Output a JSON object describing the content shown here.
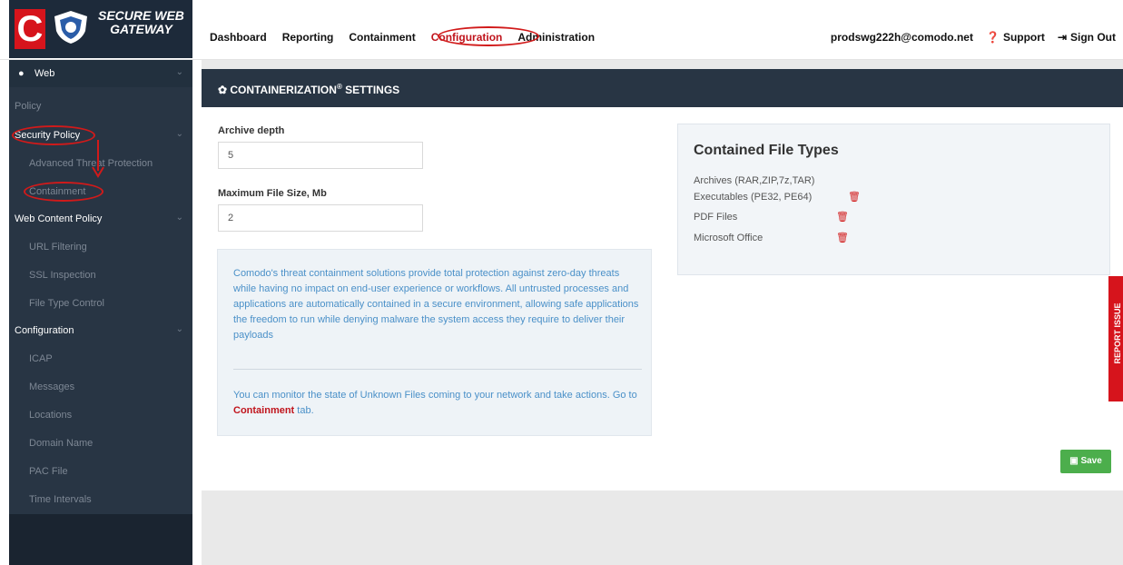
{
  "logo": {
    "line1": "SECURE WEB",
    "line2": "GATEWAY",
    "mark": "C"
  },
  "nav": {
    "items": [
      "Dashboard",
      "Reporting",
      "Containment",
      "Configuration",
      "Administration"
    ],
    "active": "Configuration"
  },
  "account": {
    "email": "prodswg222h@comodo.net",
    "support": "Support",
    "signout": "Sign Out"
  },
  "sidebar": {
    "web": "Web",
    "items": [
      {
        "label": "Policy",
        "kind": "muted"
      },
      {
        "label": "Security Policy",
        "kind": "head"
      },
      {
        "label": "Advanced Threat Protection",
        "kind": "sub"
      },
      {
        "label": "Containment",
        "kind": "sub"
      },
      {
        "label": "Web Content Policy",
        "kind": "head"
      },
      {
        "label": "URL Filtering",
        "kind": "sub"
      },
      {
        "label": "SSL Inspection",
        "kind": "sub"
      },
      {
        "label": "File Type Control",
        "kind": "sub"
      },
      {
        "label": "Configuration",
        "kind": "head"
      },
      {
        "label": "ICAP",
        "kind": "sub"
      },
      {
        "label": "Messages",
        "kind": "sub"
      },
      {
        "label": "Locations",
        "kind": "sub"
      },
      {
        "label": "Domain Name",
        "kind": "sub"
      },
      {
        "label": "PAC File",
        "kind": "sub"
      },
      {
        "label": "Time Intervals",
        "kind": "sub"
      }
    ]
  },
  "panel": {
    "title": "CONTAINERIZATION",
    "title_sup": "®",
    "title_suffix": " SETTINGS",
    "archive_label": "Archive depth",
    "archive_value": "5",
    "maxsize_label": "Maximum File Size, Mb",
    "maxsize_value": "2",
    "info_p1": "Comodo's threat containment solutions provide total protection against zero-day threats while having no impact on end-user experience or workflows. All untrusted processes and applications are automatically contained in a secure environment, allowing safe applications the freedom to run while denying malware the system access they require to deliver their payloads",
    "info_p2_before": "You can monitor the state of Unknown Files coming to your network and take actions. Go to ",
    "info_p2_link": "Containment",
    "info_p2_after": " tab.",
    "types_title": "Contained File Types",
    "types": [
      {
        "label": "Archives (RAR,ZIP,7z,TAR)",
        "deletable": false
      },
      {
        "label": "Executables (PE32, PE64)",
        "deletable": true
      },
      {
        "label": "PDF Files",
        "deletable": true
      },
      {
        "label": "Microsoft Office",
        "deletable": true
      }
    ],
    "save": "Save"
  },
  "report_issue": "REPORT ISSUE",
  "colors": {
    "accent": "#d6141c",
    "sidebar": "#283544",
    "save": "#4cae4c",
    "info_text": "#4a90c8"
  }
}
